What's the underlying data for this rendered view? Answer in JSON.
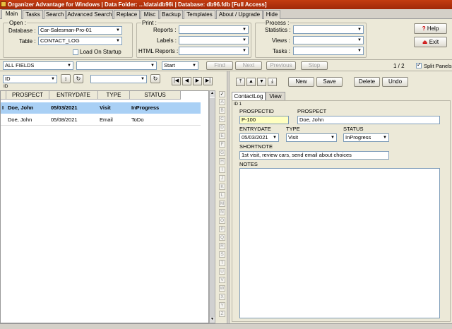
{
  "title": "Organizer Advantage for Windows | Data Folder: ...\\data\\db96\\ | Database: db96.fdb [Full Access]",
  "tabs": [
    "Main",
    "Tasks",
    "Search",
    "Advanced Search",
    "Replace",
    "Misc",
    "Backup",
    "Templates",
    "About / Upgrade",
    "Hide"
  ],
  "open": {
    "group_label": "Open :",
    "database_label": "Database :",
    "database_value": "Car-Salesman-Pro-01",
    "table_label": "Table :",
    "table_value": "CONTACT_LOG",
    "load_on_startup": "Load On Startup"
  },
  "print": {
    "group_label": "Print :",
    "reports_label": "Reports :",
    "labels_label": "Labels :",
    "html_reports_label": "HTML Reports :"
  },
  "process": {
    "group_label": "Process :",
    "statistics_label": "Statistics :",
    "views_label": "Views :",
    "tasks_label": "Tasks :"
  },
  "help_label": "Help",
  "exit_label": "Exit",
  "search": {
    "field_value": "ALL FIELDS",
    "mode_value": "Start",
    "find": "Find",
    "next": "Next",
    "previous": "Previous",
    "stop": "Stop",
    "record_position": "1 / 2",
    "split_panels": "Split Panels"
  },
  "sort": {
    "field_value": "ID",
    "sub_label": "ID"
  },
  "grid": {
    "columns": [
      "PROSPECT",
      "ENTRYDATE",
      "TYPE",
      "STATUS"
    ],
    "rows": [
      {
        "indicator": "I",
        "prospect": "Doe, John",
        "entrydate": "05/03/2021",
        "type": "Visit",
        "status": "InProgress"
      },
      {
        "indicator": "",
        "prospect": "Doe, John",
        "entrydate": "05/08/2021",
        "type": "Email",
        "status": "ToDo"
      }
    ]
  },
  "alphabet": [
    "A",
    "B",
    "C",
    "D",
    "E",
    "F",
    "G",
    "H",
    "I",
    "J",
    "K",
    "L",
    "M",
    "N",
    "O",
    "P",
    "Q",
    "R",
    "S",
    "T",
    "U",
    "V",
    "W",
    "X",
    "Y",
    "Z"
  ],
  "record_buttons": {
    "new": "New",
    "save": "Save",
    "delete": "Delete",
    "undo": "Undo"
  },
  "detail_tabs": [
    "ContactLog",
    "View"
  ],
  "record": {
    "id_label": "ID 1",
    "prospectid_label": "PROSPECTID",
    "prospectid": "P-100",
    "prospect_label": "PROSPECT",
    "prospect": "Doe, John",
    "entrydate_label": "ENTRYDATE",
    "entrydate": "05/03/2021",
    "type_label": "TYPE",
    "type": "Visit",
    "status_label": "STATUS",
    "status": "InProgress",
    "shortnote_label": "SHORTNOTE",
    "shortnote": "1st visit, review cars, send email about choices",
    "notes_label": "NOTES",
    "notes": ""
  },
  "colors": {
    "title_bar": "#b33010",
    "selected_row": "#a9d0f5",
    "panel": "#ece9d8",
    "prospectid_bg": "#ffffc0"
  }
}
